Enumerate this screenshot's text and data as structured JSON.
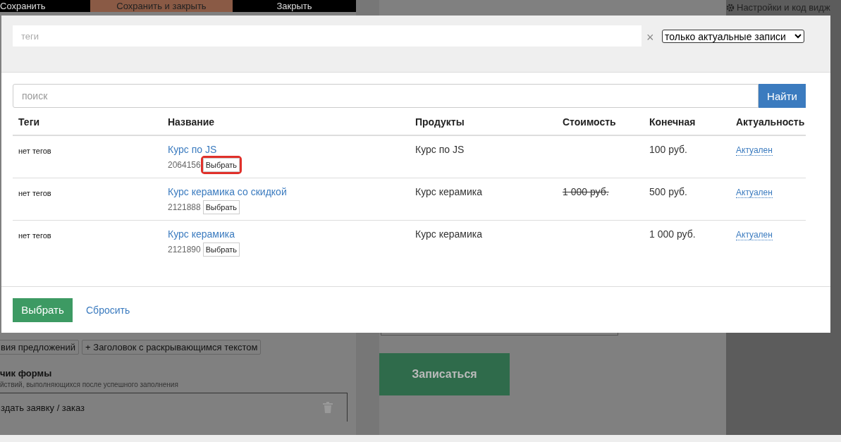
{
  "background": {
    "toolbar": [
      {
        "label": "Сохранить",
        "kind": "plain"
      },
      {
        "label": "Сохранить и закрыть",
        "kind": "accent"
      },
      {
        "label": "Закрыть",
        "kind": "plain"
      }
    ],
    "settings_link": "Настройки и код видж",
    "chips": [
      "вия предложений",
      "+ Заголовок с раскрывающимся текстом"
    ],
    "section_title": "чик формы",
    "section_hint": "йствий, выполняющихся после успешного заполнения",
    "action_item": "здать заявку / заказ",
    "submit_button": "Записаться"
  },
  "modal": {
    "tags_field": {
      "placeholder": "теги"
    },
    "clear_icon": "×",
    "filter_select": "только актуальные записи",
    "search": {
      "placeholder": "поиск",
      "button": "Найти"
    },
    "table": {
      "columns": [
        "Теги",
        "Название",
        "Продукты",
        "Стоимость",
        "Конечная",
        "Актуальность"
      ],
      "rows": [
        {
          "tags": "нет тегов",
          "name": "Курс по JS",
          "id": "2064156",
          "pick": "Выбрать",
          "highlighted": true,
          "product": "Курс по JS",
          "price": "",
          "final": "100 руб.",
          "status": "Актуален"
        },
        {
          "tags": "нет тегов",
          "name": "Курс керамика со скидкой",
          "id": "2121888",
          "pick": "Выбрать",
          "highlighted": false,
          "product": "Курс керамика",
          "price": "1 000 руб.",
          "final": "500 руб.",
          "status": "Актуален"
        },
        {
          "tags": "нет тегов",
          "name": "Курс керамика",
          "id": "2121890",
          "pick": "Выбрать",
          "highlighted": false,
          "product": "Курс керамика",
          "price": "",
          "final": "1 000 руб.",
          "status": "Актуален"
        }
      ]
    },
    "footer": {
      "primary": "Выбрать",
      "reset": "Сбросить"
    }
  }
}
